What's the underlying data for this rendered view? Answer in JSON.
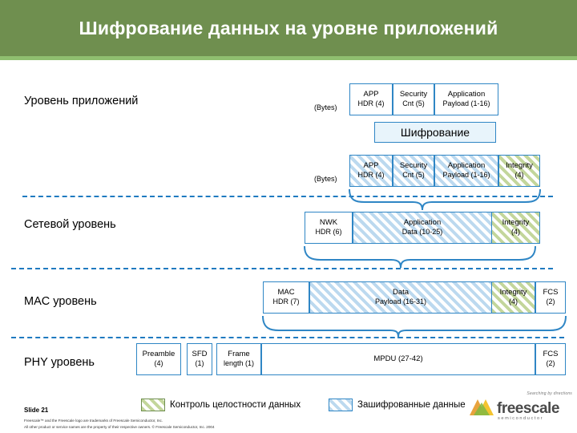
{
  "title": "Шифрование данных на уровне приложений",
  "encryption_banner": "Шифрование",
  "bytes_label": "(Bytes)",
  "layers": {
    "application": "Уровень приложений",
    "network": "Сетевой уровень",
    "mac": "MAC уровень",
    "phy": "PHY уровень"
  },
  "rows": {
    "app_plain": [
      {
        "l1": "APP",
        "l2": "HDR (4)"
      },
      {
        "l1": "Security",
        "l2": "Cnt (5)"
      },
      {
        "l1": "Application",
        "l2": "Payload (1-16)"
      }
    ],
    "app_encrypted": [
      {
        "l1": "APP",
        "l2": "HDR (4)"
      },
      {
        "l1": "Security",
        "l2": "Cnt (5)"
      },
      {
        "l1": "Application",
        "l2": "Payload (1-16)"
      },
      {
        "l1": "Integrity",
        "l2": "(4)"
      }
    ],
    "network": [
      {
        "l1": "NWK",
        "l2": "HDR (6)"
      },
      {
        "l1": "Application",
        "l2": "Data (10-25)"
      },
      {
        "l1": "Integrity",
        "l2": "(4)"
      }
    ],
    "mac": [
      {
        "l1": "MAC",
        "l2": "HDR (7)"
      },
      {
        "l1": "Data",
        "l2": "Payload (16-31)"
      },
      {
        "l1": "Integrity",
        "l2": "(4)"
      },
      {
        "l1": "FCS",
        "l2": "(2)"
      }
    ],
    "phy": [
      {
        "l1": "Preamble",
        "l2": "(4)"
      },
      {
        "l1": "SFD",
        "l2": "(1)"
      },
      {
        "l1": "Frame",
        "l2": "length (1)"
      },
      {
        "l1": "MPDU (27-42)",
        "l2": ""
      },
      {
        "l1": "FCS",
        "l2": "(2)"
      }
    ]
  },
  "legend": {
    "integrity": "Контроль целостности данных",
    "encrypted": "Зашифрованные данные"
  },
  "footer": {
    "slide_number": "Slide 21",
    "legal_line1": "Freescale™ and the Freescale logo are trademarks of Freescale Semiconductor, Inc.",
    "legal_line2": "All other product or service names are the property of their respective owners. © Freescale Semiconductor, Inc. 2004"
  },
  "logo": {
    "tagline": "Searching by directions",
    "name": "freescale",
    "sub": "semiconductor"
  },
  "colors": {
    "title_band": "#6f8f4f",
    "title_rule": "#8fbf6f",
    "box_border": "#2f86c5",
    "banner_bg": "#e8f4fb"
  }
}
